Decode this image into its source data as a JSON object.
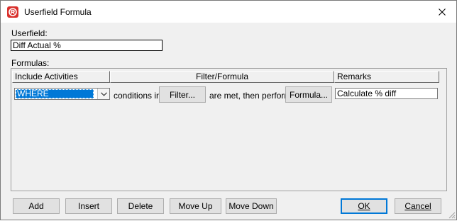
{
  "window": {
    "title": "Userfield Formula"
  },
  "userfield": {
    "label": "Userfield:",
    "value": "Diff Actual %"
  },
  "formulas": {
    "label": "Formulas:",
    "columns": [
      "Include Activities",
      "Filter/Formula",
      "Remarks"
    ],
    "rows": [
      {
        "include": "WHERE",
        "text_conditions": "conditions in",
        "filter_button": "Filter...",
        "text_met": "are met, then perform",
        "formula_button": "Formula...",
        "remarks": "Calculate % diff"
      }
    ]
  },
  "buttons": {
    "add": "Add",
    "insert": "Insert",
    "delete": "Delete",
    "move_up": "Move Up",
    "move_down": "Move Down",
    "ok": "OK",
    "cancel": "Cancel"
  },
  "colors": {
    "app_icon": "#d9302c",
    "selection": "#0078d7"
  }
}
